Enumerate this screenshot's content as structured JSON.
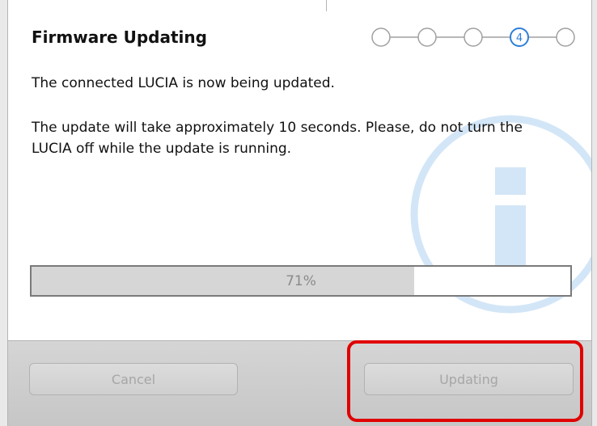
{
  "dialog": {
    "title": "Firmware Updating",
    "message_primary": "The connected LUCIA is now being updated.",
    "message_secondary": "The update will take approximately 10 seconds. Please, do not turn the LUCIA off while the update is running."
  },
  "steps": {
    "total": 5,
    "current": 4,
    "current_label": "4"
  },
  "progress": {
    "value": 71,
    "label": "71%"
  },
  "buttons": {
    "cancel_label": "Cancel",
    "updating_label": "Updating"
  },
  "colors": {
    "highlight": "#e00000",
    "step_active": "#2f7fd8",
    "watermark": "#cfe3f6"
  },
  "icons": {
    "watermark": "info-icon"
  }
}
